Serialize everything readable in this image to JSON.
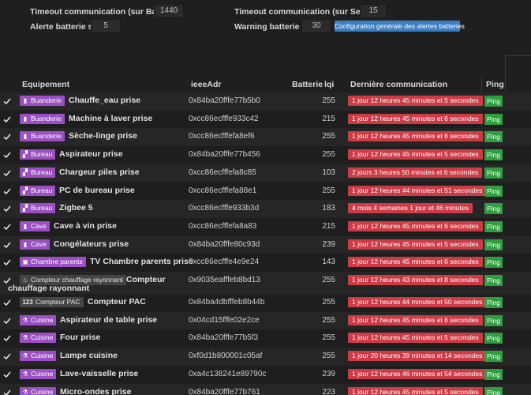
{
  "config": {
    "timeout_battery_label": "Timeout communication (sur Batterie)",
    "timeout_battery_value": "1440",
    "timeout_mains_label": "Timeout communication (sur Secteur)",
    "timeout_mains_value": "15",
    "battery_alert_label": "Alerte batterie si <",
    "battery_alert_value": "5",
    "battery_warning_label": "Warning batterie si <",
    "battery_warning_value": "30",
    "global_alert_button": "Configuration générale des alertes batteries"
  },
  "table": {
    "headers": {
      "equipment": "Equipement",
      "ieee": "ieeeAdr",
      "battery": "Batterie",
      "lqi": "lqi",
      "last_comm": "Dernière communication",
      "ping": "Ping"
    },
    "ping_label": "Ping",
    "rows": [
      {
        "room": "Buanderie",
        "icon": "plug-icon",
        "glyph": "▮",
        "style": "purple",
        "name": "Chauffe_eau prise",
        "ieee": "0x84ba20fffe77b5b0",
        "lqi": "255",
        "last": "1 jour 12 heures 45 minutes et 5 secondes"
      },
      {
        "room": "Buanderie",
        "icon": "plug-icon",
        "glyph": "▮",
        "style": "purple",
        "name": "Machine à laver prise",
        "ieee": "0xcc86ecfffe933c42",
        "lqi": "215",
        "last": "1 jour 12 heures 45 minutes et 6 secondes"
      },
      {
        "room": "Buanderie",
        "icon": "plug-icon",
        "glyph": "▮",
        "style": "purple",
        "name": "Sèche-linge prise",
        "ieee": "0xcc86ecfffefa8ef6",
        "lqi": "255",
        "last": "1 jour 12 heures 45 minutes et 6 secondes"
      },
      {
        "room": "Bureau",
        "icon": "desk-icon",
        "glyph": "▞",
        "style": "purple",
        "name": "Aspirateur prise",
        "ieee": "0x84ba20fffe77b456",
        "lqi": "255",
        "last": "1 jour 12 heures 45 minutes et 5 secondes"
      },
      {
        "room": "Bureau",
        "icon": "desk-icon",
        "glyph": "▞",
        "style": "purple",
        "name": "Chargeur piles prise",
        "ieee": "0xcc86ecfffefa8c85",
        "lqi": "103",
        "last": "2 jours 3 heures 50 minutes et 6 secondes"
      },
      {
        "room": "Bureau",
        "icon": "desk-icon",
        "glyph": "▞",
        "style": "purple",
        "name": "PC de bureau prise",
        "ieee": "0xcc86ecfffefa88e1",
        "lqi": "255",
        "last": "1 jour 12 heures 44 minutes et 51 secondes"
      },
      {
        "room": "Bureau",
        "icon": "desk-icon",
        "glyph": "▞",
        "style": "purple",
        "name": "Zigbee 5",
        "ieee": "0xcc86ecfffe933b3d",
        "lqi": "183",
        "last": "4 mois 4 semaines 1 jour et 46 minutes"
      },
      {
        "room": "Cave",
        "icon": "plug-icon",
        "glyph": "▮",
        "style": "purple",
        "name": "Cave à vin prise",
        "ieee": "0xcc86ecfffefa8a83",
        "lqi": "215",
        "last": "1 jour 12 heures 45 minutes et 6 secondes"
      },
      {
        "room": "Cave",
        "icon": "plug-icon",
        "glyph": "▮",
        "style": "purple",
        "name": "Congélateurs prise",
        "ieee": "0x84ba20fffe80c93d",
        "lqi": "239",
        "last": "1 jour 12 heures 45 minutes et 5 secondes"
      },
      {
        "room": "Chambre parents",
        "icon": "bed-icon",
        "glyph": "▣",
        "style": "purple",
        "name": "TV Chambre parents prise",
        "ieee": "0xcc86ecfffe4e9e24",
        "lqi": "143",
        "last": "1 jour 12 heures 45 minutes et 6 secondes"
      },
      {
        "room": "Compteur chauffage rayonnant",
        "icon": "flame-icon",
        "glyph": "♨",
        "style": "gray",
        "name": "Compteur chauffage rayonnant",
        "ieee": "0x9035eafffeb8bd13",
        "lqi": "255",
        "last": "1 jour 12 heures 43 minutes et 8 secondes",
        "tall": true
      },
      {
        "room": "Compteur PAC",
        "icon": "counter-icon",
        "glyph": "123",
        "style": "gray",
        "name": "Compteur PAC",
        "ieee": "0x84ba4dbfffeb8b44b",
        "lqi": "255",
        "last": "1 jour 12 heures 44 minutes et 50 secondes"
      },
      {
        "room": "Cuisine",
        "icon": "kitchen-icon",
        "glyph": "⚗",
        "style": "purple",
        "name": "Aspirateur de table prise",
        "ieee": "0x04cd15fffe02e2ce",
        "lqi": "255",
        "last": "1 jour 12 heures 45 minutes et 6 secondes"
      },
      {
        "room": "Cuisine",
        "icon": "kitchen-icon",
        "glyph": "⚗",
        "style": "purple",
        "name": "Four prise",
        "ieee": "0x84ba20fffe77b5f3",
        "lqi": "255",
        "last": "1 jour 12 heures 45 minutes et 5 secondes"
      },
      {
        "room": "Cuisine",
        "icon": "kitchen-icon",
        "glyph": "⚗",
        "style": "purple",
        "name": "Lampe cuisine",
        "ieee": "0xf0d1b800001c05af",
        "lqi": "255",
        "last": "1 jour 20 heures 39 minutes et 14 secondes"
      },
      {
        "room": "Cuisine",
        "icon": "kitchen-icon",
        "glyph": "⚗",
        "style": "purple",
        "name": "Lave-vaisselle prise",
        "ieee": "0xa4c138241e89790c",
        "lqi": "239",
        "last": "1 jour 12 heures 46 minutes et 54 secondes"
      },
      {
        "room": "Cuisine",
        "icon": "kitchen-icon",
        "glyph": "⚗",
        "style": "purple",
        "name": "Micro-ondes prise",
        "ieee": "0x84ba20fffe77b761",
        "lqi": "223",
        "last": "1 jour 12 heures 45 minutes et 5 secondes"
      }
    ]
  }
}
